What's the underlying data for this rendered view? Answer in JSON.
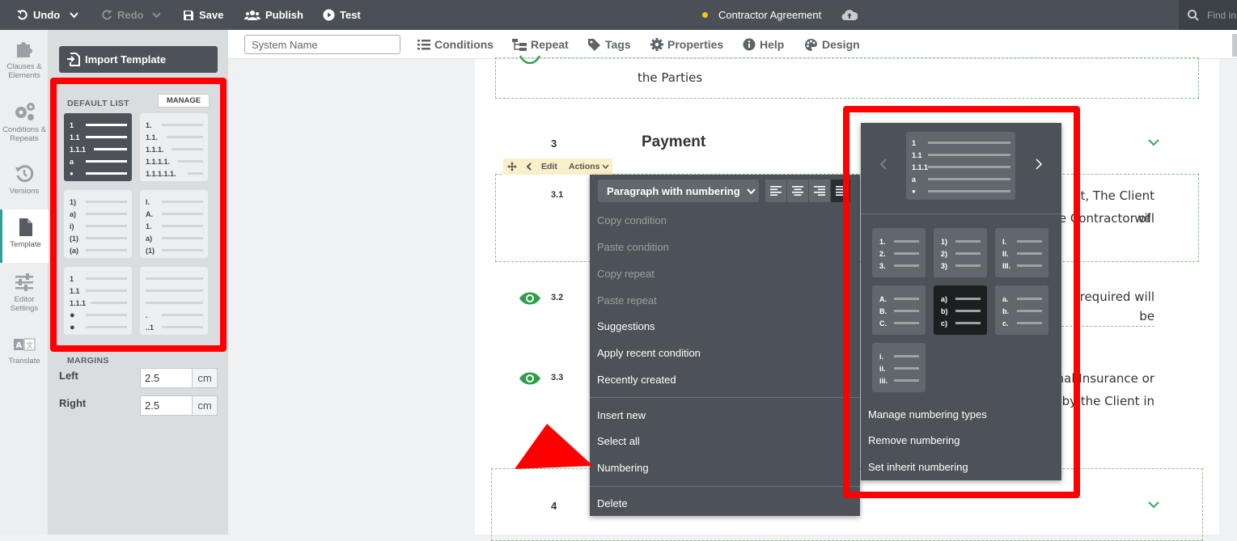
{
  "topbar": {
    "undo": "Undo",
    "redo": "Redo",
    "save": "Save",
    "publish": "Publish",
    "test": "Test",
    "doc_title": "Contractor Agreement",
    "find_placeholder": "Find in"
  },
  "leftnav": {
    "items": [
      {
        "label1": "Clauses &",
        "label2": "Elements"
      },
      {
        "label1": "Conditions &",
        "label2": "Repeats"
      },
      {
        "label1": "Versions",
        "label2": ""
      },
      {
        "label1": "Template",
        "label2": ""
      },
      {
        "label1": "Editor",
        "label2": "Settings"
      },
      {
        "label1": "Translate",
        "label2": ""
      }
    ]
  },
  "panel": {
    "import_template": "Import Template",
    "default_list": "DEFAULT LIST",
    "manage": "MANAGE",
    "cards": [
      [
        "1",
        "1.1",
        "1.1.1",
        "a",
        "●"
      ],
      [
        "1.",
        "1.1.",
        "1.1.1.",
        "1.1.1.1.",
        "1.1.1.1.1."
      ],
      [
        "1)",
        "a)",
        "i)",
        "(1)",
        "(a)"
      ],
      [
        "I.",
        "A.",
        "1.",
        "a)",
        "(1)"
      ],
      [
        "1",
        "1.1",
        "1.1.1",
        "●",
        "●"
      ],
      [
        "",
        "",
        "",
        ".",
        "..1"
      ]
    ],
    "margins": "MARGINS",
    "left_label": "Left",
    "left_value": "2.5",
    "right_label": "Right",
    "right_value": "2.5",
    "unit": "cm"
  },
  "toolbar": {
    "system_name_placeholder": "System Name",
    "conditions": "Conditions",
    "repeat": "Repeat",
    "tags": "Tags",
    "properties": "Properties",
    "help": "Help",
    "design": "Design"
  },
  "document": {
    "top_text": "the Parties",
    "section3_num": "3",
    "section3_title": "Payment",
    "p31_num": "3.1",
    "p31_line1": "t, The Client will",
    "p31_line2": "e  Contractor  of",
    "p32_num": "3.2",
    "p32_line1": "required will be",
    "p33_num": "3.3",
    "p33_line1": "nal  Insurance  or",
    "p33_line2": "by the Client in",
    "section4_num": "4"
  },
  "row_actions": {
    "edit": "Edit",
    "actions": "Actions"
  },
  "context_menu": {
    "dropdown": "Paragraph with numbering",
    "items": [
      {
        "label": "Copy condition",
        "enabled": false
      },
      {
        "label": "Paste condition",
        "enabled": false
      },
      {
        "label": "Copy repeat",
        "enabled": false
      },
      {
        "label": "Paste repeat",
        "enabled": false
      },
      {
        "label": "Suggestions",
        "enabled": true
      },
      {
        "label": "Apply recent condition",
        "enabled": true
      },
      {
        "label": "Recently created",
        "enabled": true
      },
      {
        "label": "Insert new",
        "enabled": true
      },
      {
        "label": "Select all",
        "enabled": true
      },
      {
        "label": "Numbering",
        "enabled": true
      },
      {
        "label": "Delete",
        "enabled": true
      }
    ]
  },
  "numbering_menu": {
    "preview": [
      "1",
      "1.1",
      "1.1.1",
      "a",
      "●"
    ],
    "tiles": [
      [
        "1.",
        "2.",
        "3."
      ],
      [
        "1)",
        "2)",
        "3)"
      ],
      [
        "I.",
        "II.",
        "III."
      ],
      [
        "A.",
        "B.",
        "C."
      ],
      [
        "a)",
        "b)",
        "c)"
      ],
      [
        "a.",
        "b.",
        "c."
      ],
      [
        "i.",
        "ii.",
        "iii."
      ]
    ],
    "selected_tile": 4,
    "manage": "Manage numbering types",
    "remove": "Remove numbering",
    "inherit": "Set inherit numbering"
  },
  "colors": {
    "topbar": "#4a5055",
    "menu": "#4c5257",
    "highlight": "#ff0000",
    "eye": "#2e9e4a"
  }
}
